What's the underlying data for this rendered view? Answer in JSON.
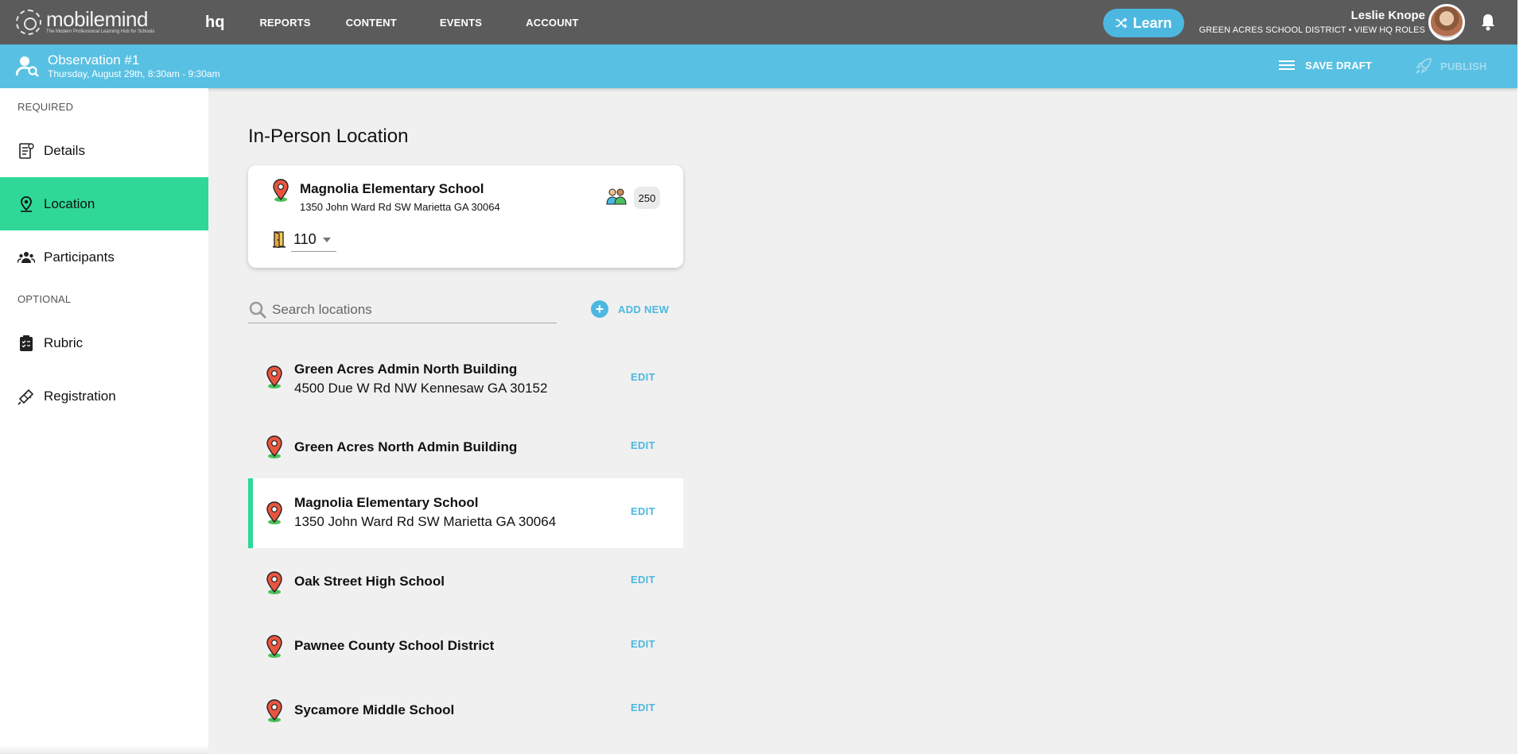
{
  "brand": {
    "name": "mobilemind",
    "tagline": "The Modern Professional Learning Hub for Schools",
    "product": "hq"
  },
  "nav": {
    "items": [
      "REPORTS",
      "CONTENT",
      "EVENTS",
      "ACCOUNT"
    ]
  },
  "learn_button": {
    "label": "Learn"
  },
  "user": {
    "name": "Leslie Knope",
    "subtitle": "GREEN ACRES SCHOOL DISTRICT • VIEW HQ ROLES"
  },
  "observation": {
    "title": "Observation #1",
    "date": "Thursday, August 29th, 8:30am - 9:30am"
  },
  "actions": {
    "save_draft": "SAVE DRAFT",
    "publish": "PUBLISH"
  },
  "sidebar": {
    "required_label": "REQUIRED",
    "optional_label": "OPTIONAL",
    "items": [
      {
        "label": "Details",
        "icon": "document-icon"
      },
      {
        "label": "Location",
        "icon": "location-pin-icon",
        "active": true
      },
      {
        "label": "Participants",
        "icon": "people-icon"
      },
      {
        "label": "Rubric",
        "icon": "clipboard-icon"
      },
      {
        "label": "Registration",
        "icon": "ticket-icon"
      }
    ]
  },
  "main": {
    "title": "In-Person Location",
    "selected_location": {
      "name": "Magnolia Elementary School",
      "address": "1350 John Ward Rd SW Marietta GA 30064",
      "capacity": "250",
      "room": "110"
    },
    "search": {
      "placeholder": "Search locations"
    },
    "add_new_label": "ADD NEW",
    "locations": [
      {
        "name": "Green Acres Admin North Building",
        "address": "4500 Due W Rd NW Kennesaw GA 30152",
        "edit": "EDIT"
      },
      {
        "name": "Green Acres North Admin Building",
        "address": "",
        "edit": "EDIT"
      },
      {
        "name": "Magnolia Elementary School",
        "address": "1350 John Ward Rd SW Marietta GA 30064",
        "edit": "EDIT",
        "selected": true
      },
      {
        "name": "Oak Street High School",
        "address": "",
        "edit": "EDIT"
      },
      {
        "name": "Pawnee County School District",
        "address": "",
        "edit": "EDIT"
      },
      {
        "name": "Sycamore Middle School",
        "address": "",
        "edit": "EDIT"
      }
    ]
  },
  "colors": {
    "topbar": "#5b5b5b",
    "subbar": "#58c0e3",
    "accent_green": "#2fd896",
    "accent_blue": "#4cb8e0",
    "pin_red": "#e8553f"
  }
}
